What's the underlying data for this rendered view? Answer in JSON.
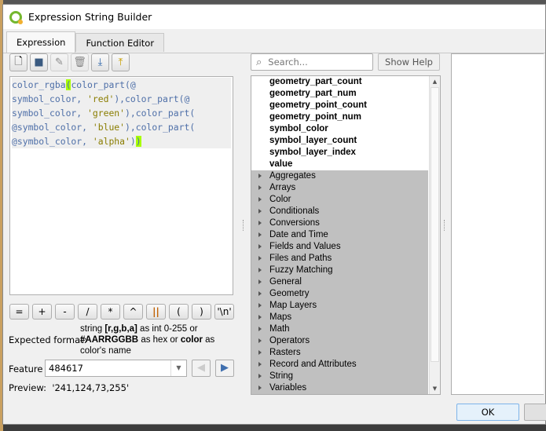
{
  "window": {
    "title": "Expression String Builder"
  },
  "tabs": [
    {
      "label": "Expression",
      "active": true
    },
    {
      "label": "Function Editor",
      "active": false
    }
  ],
  "toolbar": [
    "new-file-icon",
    "save-icon",
    "edit-icon",
    "delete-icon",
    "import-icon",
    "export-icon"
  ],
  "expression": {
    "lines": [
      [
        "color_rgba",
        "(",
        "color_part(@"
      ],
      [
        "symbol_color, ",
        "'red'",
        "),color_part(@"
      ],
      [
        "symbol_color, ",
        "'green'",
        "),color_part("
      ],
      [
        "@symbol_color, ",
        "'blue'",
        "),color_part("
      ],
      [
        "@symbol_color, ",
        "'alpha'",
        "))"
      ]
    ]
  },
  "operators": [
    "=",
    "+",
    "-",
    "/",
    "*",
    "^",
    "||",
    "(",
    ")",
    "'\\n'"
  ],
  "expected_format": {
    "label": "Expected format:",
    "t1": "string ",
    "b1": "[r,g,b,a]",
    "t2": " as int 0-255 or ",
    "b2": "#AARRGGBB",
    "t3": " as hex or ",
    "b3": "color",
    "t4": " as color's name"
  },
  "feature": {
    "label": "Feature",
    "value": "484617"
  },
  "preview": {
    "label": "Preview:",
    "value": "'241,124,73,255'"
  },
  "search": {
    "placeholder": "Search..."
  },
  "show_help": "Show Help",
  "functions": [
    "geometry_part_count",
    "geometry_part_num",
    "geometry_point_count",
    "geometry_point_num",
    "symbol_color",
    "symbol_layer_count",
    "symbol_layer_index",
    "value"
  ],
  "groups": [
    "Aggregates",
    "Arrays",
    "Color",
    "Conditionals",
    "Conversions",
    "Date and Time",
    "Fields and Values",
    "Files and Paths",
    "Fuzzy Matching",
    "General",
    "Geometry",
    "Map Layers",
    "Maps",
    "Math",
    "Operators",
    "Rasters",
    "Record and Attributes",
    "String",
    "Variables"
  ],
  "buttons": {
    "ok": "OK"
  },
  "colors": {
    "highlight": "#a8ff00",
    "string": "#8a7d00",
    "code": "#4e6fa8",
    "group_bg": "#c0c0c0"
  }
}
